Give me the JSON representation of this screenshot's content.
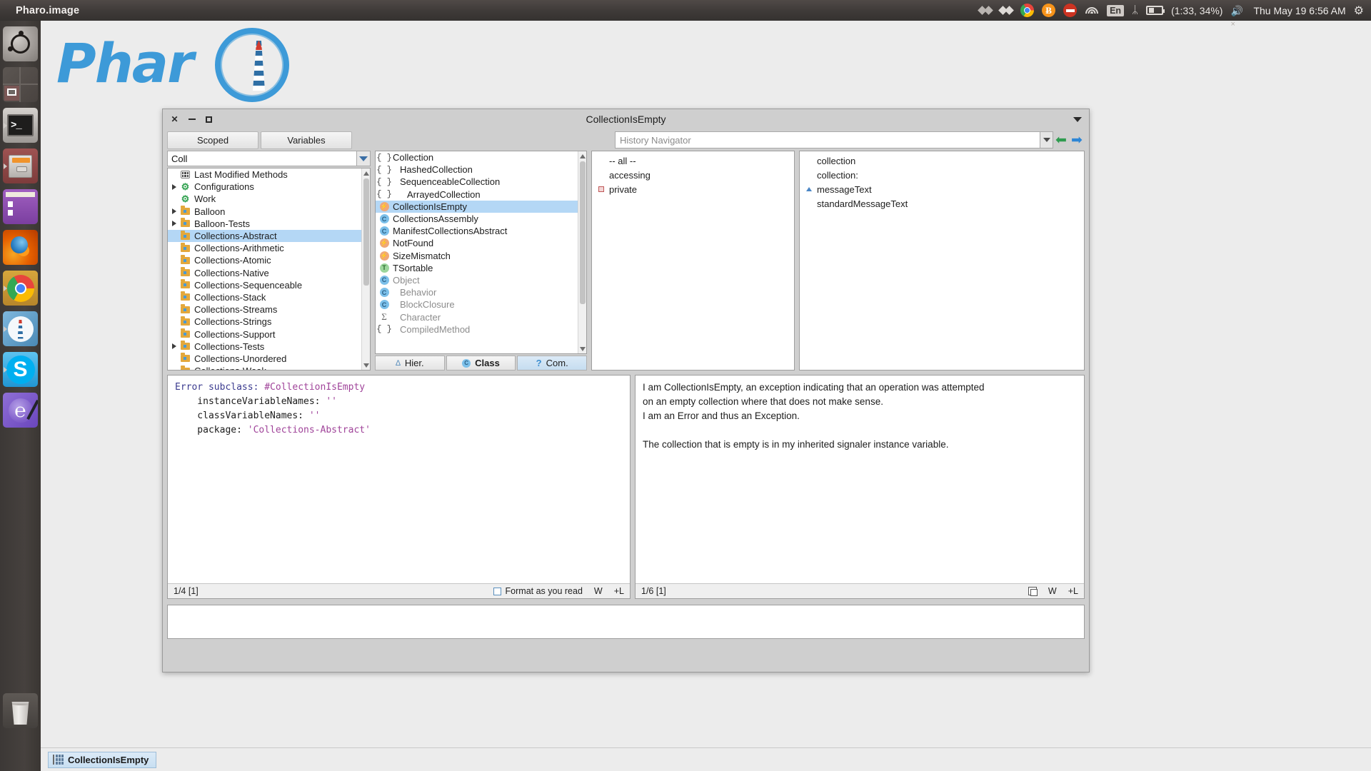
{
  "top_panel": {
    "app_title": "Pharo.image",
    "tray": {
      "dropbox1": "dropbox-icon",
      "dropbox2": "dropbox-icon",
      "chrome": "chrome-icon",
      "bitcoin_label": "Ƀ",
      "noentry": "no-entry-icon",
      "wifi": "wifi-icon",
      "keyboard_layout": "En",
      "bluetooth": "ᛦ",
      "battery_label": "(1:33, 34%)",
      "volume": "volume-muted-icon",
      "datetime": "Thu May 19  6:56 AM",
      "gear": "gear-icon"
    }
  },
  "launcher": {
    "items": [
      {
        "name": "ubuntu-dash",
        "label": "Ubuntu Dash"
      },
      {
        "name": "workspace-switcher",
        "label": "Workspace Switcher"
      },
      {
        "name": "terminal",
        "label": "Terminal"
      },
      {
        "name": "files",
        "label": "Files"
      },
      {
        "name": "software-center",
        "label": "Ubuntu Software"
      },
      {
        "name": "firefox",
        "label": "Firefox"
      },
      {
        "name": "chrome",
        "label": "Google Chrome"
      },
      {
        "name": "pharo",
        "label": "Pharo"
      },
      {
        "name": "skype",
        "label": "Skype"
      },
      {
        "name": "emacs",
        "label": "Emacs"
      }
    ],
    "trash_label": "Trash"
  },
  "desktop": {
    "logo_word": "Phar"
  },
  "window": {
    "title": "CollectionIsEmpty",
    "close_label": "✕",
    "minimize_label": "minimize",
    "maximize_label": "maximize",
    "menu_label": "window-menu"
  },
  "toolbar": {
    "scoped_label": "Scoped",
    "variables_label": "Variables",
    "history_placeholder": "History Navigator",
    "back_label": "⬅",
    "forward_label": "➡"
  },
  "packages": {
    "filter_value": "Coll",
    "items": [
      {
        "label": "Last Modified Methods",
        "icon": "grid-icon",
        "expandable": false,
        "indent": 1,
        "selected": false
      },
      {
        "label": "Configurations",
        "icon": "configuration-icon",
        "expandable": true,
        "indent": 0,
        "selected": false
      },
      {
        "label": "Work",
        "icon": "configuration-icon",
        "expandable": false,
        "indent": 1,
        "selected": false
      },
      {
        "label": "Balloon",
        "icon": "package-icon",
        "expandable": true,
        "indent": 0,
        "selected": false
      },
      {
        "label": "Balloon-Tests",
        "icon": "package-icon",
        "expandable": true,
        "indent": 0,
        "selected": false
      },
      {
        "label": "Collections-Abstract",
        "icon": "package-icon",
        "expandable": false,
        "indent": 1,
        "selected": true
      },
      {
        "label": "Collections-Arithmetic",
        "icon": "package-icon",
        "expandable": false,
        "indent": 1,
        "selected": false
      },
      {
        "label": "Collections-Atomic",
        "icon": "package-icon",
        "expandable": false,
        "indent": 1,
        "selected": false
      },
      {
        "label": "Collections-Native",
        "icon": "package-icon",
        "expandable": false,
        "indent": 1,
        "selected": false
      },
      {
        "label": "Collections-Sequenceable",
        "icon": "package-icon",
        "expandable": false,
        "indent": 1,
        "selected": false
      },
      {
        "label": "Collections-Stack",
        "icon": "package-icon",
        "expandable": false,
        "indent": 1,
        "selected": false
      },
      {
        "label": "Collections-Streams",
        "icon": "package-icon",
        "expandable": false,
        "indent": 1,
        "selected": false
      },
      {
        "label": "Collections-Strings",
        "icon": "package-icon",
        "expandable": false,
        "indent": 1,
        "selected": false
      },
      {
        "label": "Collections-Support",
        "icon": "package-icon",
        "expandable": false,
        "indent": 1,
        "selected": false
      },
      {
        "label": "Collections-Tests",
        "icon": "package-icon",
        "expandable": true,
        "indent": 0,
        "selected": false
      },
      {
        "label": "Collections-Unordered",
        "icon": "package-icon",
        "expandable": false,
        "indent": 1,
        "selected": false
      },
      {
        "label": "Collections-Weak",
        "icon": "package-icon",
        "expandable": false,
        "indent": 1,
        "selected": false
      }
    ]
  },
  "classes": {
    "items": [
      {
        "label": "Collection",
        "icon": "trait-brace-icon",
        "indent": 0,
        "selected": false,
        "dim": false
      },
      {
        "label": "HashedCollection",
        "icon": "trait-brace-icon",
        "indent": 1,
        "selected": false,
        "dim": false
      },
      {
        "label": "SequenceableCollection",
        "icon": "trait-brace-icon",
        "indent": 1,
        "selected": false,
        "dim": false
      },
      {
        "label": "ArrayedCollection",
        "icon": "trait-brace-icon",
        "indent": 2,
        "selected": false,
        "dim": false
      },
      {
        "label": "CollectionIsEmpty",
        "icon": "exception-icon",
        "indent": 0,
        "selected": true,
        "dim": false
      },
      {
        "label": "CollectionsAssembly",
        "icon": "class-icon",
        "indent": 0,
        "selected": false,
        "dim": false
      },
      {
        "label": "ManifestCollectionsAbstract",
        "icon": "class-icon",
        "indent": 0,
        "selected": false,
        "dim": false
      },
      {
        "label": "NotFound",
        "icon": "exception-icon",
        "indent": 0,
        "selected": false,
        "dim": false
      },
      {
        "label": "SizeMismatch",
        "icon": "exception-icon",
        "indent": 0,
        "selected": false,
        "dim": false
      },
      {
        "label": "TSortable",
        "icon": "trait-icon",
        "indent": 0,
        "selected": false,
        "dim": false
      },
      {
        "label": "Object",
        "icon": "class-icon",
        "indent": 0,
        "selected": false,
        "dim": true
      },
      {
        "label": "Behavior",
        "icon": "class-icon",
        "indent": 1,
        "selected": false,
        "dim": true
      },
      {
        "label": "BlockClosure",
        "icon": "class-icon",
        "indent": 1,
        "selected": false,
        "dim": true
      },
      {
        "label": "Character",
        "icon": "sigma-icon",
        "indent": 1,
        "selected": false,
        "dim": true
      },
      {
        "label": "CompiledMethod",
        "icon": "trait-brace-icon",
        "indent": 1,
        "selected": false,
        "dim": true
      }
    ],
    "tabs": [
      {
        "label": "Hier.",
        "icon": "hierarchy-icon",
        "active": false,
        "strong": false
      },
      {
        "label": "Class",
        "icon": "class-icon",
        "active": false,
        "strong": true
      },
      {
        "label": "Com.",
        "icon": "question-icon",
        "active": true,
        "strong": false
      }
    ]
  },
  "protocols": {
    "items": [
      {
        "label": "-- all --",
        "marker": "none"
      },
      {
        "label": "accessing",
        "marker": "none"
      },
      {
        "label": "private",
        "marker": "red-square"
      }
    ]
  },
  "methods": {
    "items": [
      {
        "label": "collection",
        "marker": "none"
      },
      {
        "label": "collection:",
        "marker": "none"
      },
      {
        "label": "messageText",
        "marker": "blue-triangle"
      },
      {
        "label": "standardMessageText",
        "marker": "none"
      }
    ]
  },
  "code_editor": {
    "lines": [
      {
        "parts": [
          {
            "t": "Error subclass: ",
            "c": "kw"
          },
          {
            "t": "#CollectionIsEmpty",
            "c": "sym"
          }
        ]
      },
      {
        "parts": [
          {
            "t": "    instanceVariableNames: ",
            "c": "plain"
          },
          {
            "t": "''",
            "c": "str"
          }
        ]
      },
      {
        "parts": [
          {
            "t": "    classVariableNames: ",
            "c": "plain"
          },
          {
            "t": "''",
            "c": "str"
          }
        ]
      },
      {
        "parts": [
          {
            "t": "    package: ",
            "c": "plain"
          },
          {
            "t": "'Collections-Abstract'",
            "c": "str"
          }
        ]
      }
    ],
    "status": {
      "position": "1/4 [1]",
      "format_label": "Format as you read",
      "wrap_label": "W",
      "line_label": "+L"
    }
  },
  "comment_editor": {
    "text": "I am CollectionIsEmpty, an exception indicating that an operation was attempted\non an empty collection where that does not make sense.\nI am an Error and thus an Exception.\n\nThe collection that is empty is in my inherited signaler instance variable.",
    "status": {
      "position": "1/6 [1]",
      "copy_label": "copy-icon",
      "wrap_label": "W",
      "line_label": "+L"
    }
  },
  "taskbar": {
    "item_label": "CollectionIsEmpty"
  },
  "colors": {
    "selection": "#b4d7f5",
    "accent": "#3d9ad8",
    "panel_bg": "#cfcfcf",
    "desktop_bg": "#ececec"
  }
}
